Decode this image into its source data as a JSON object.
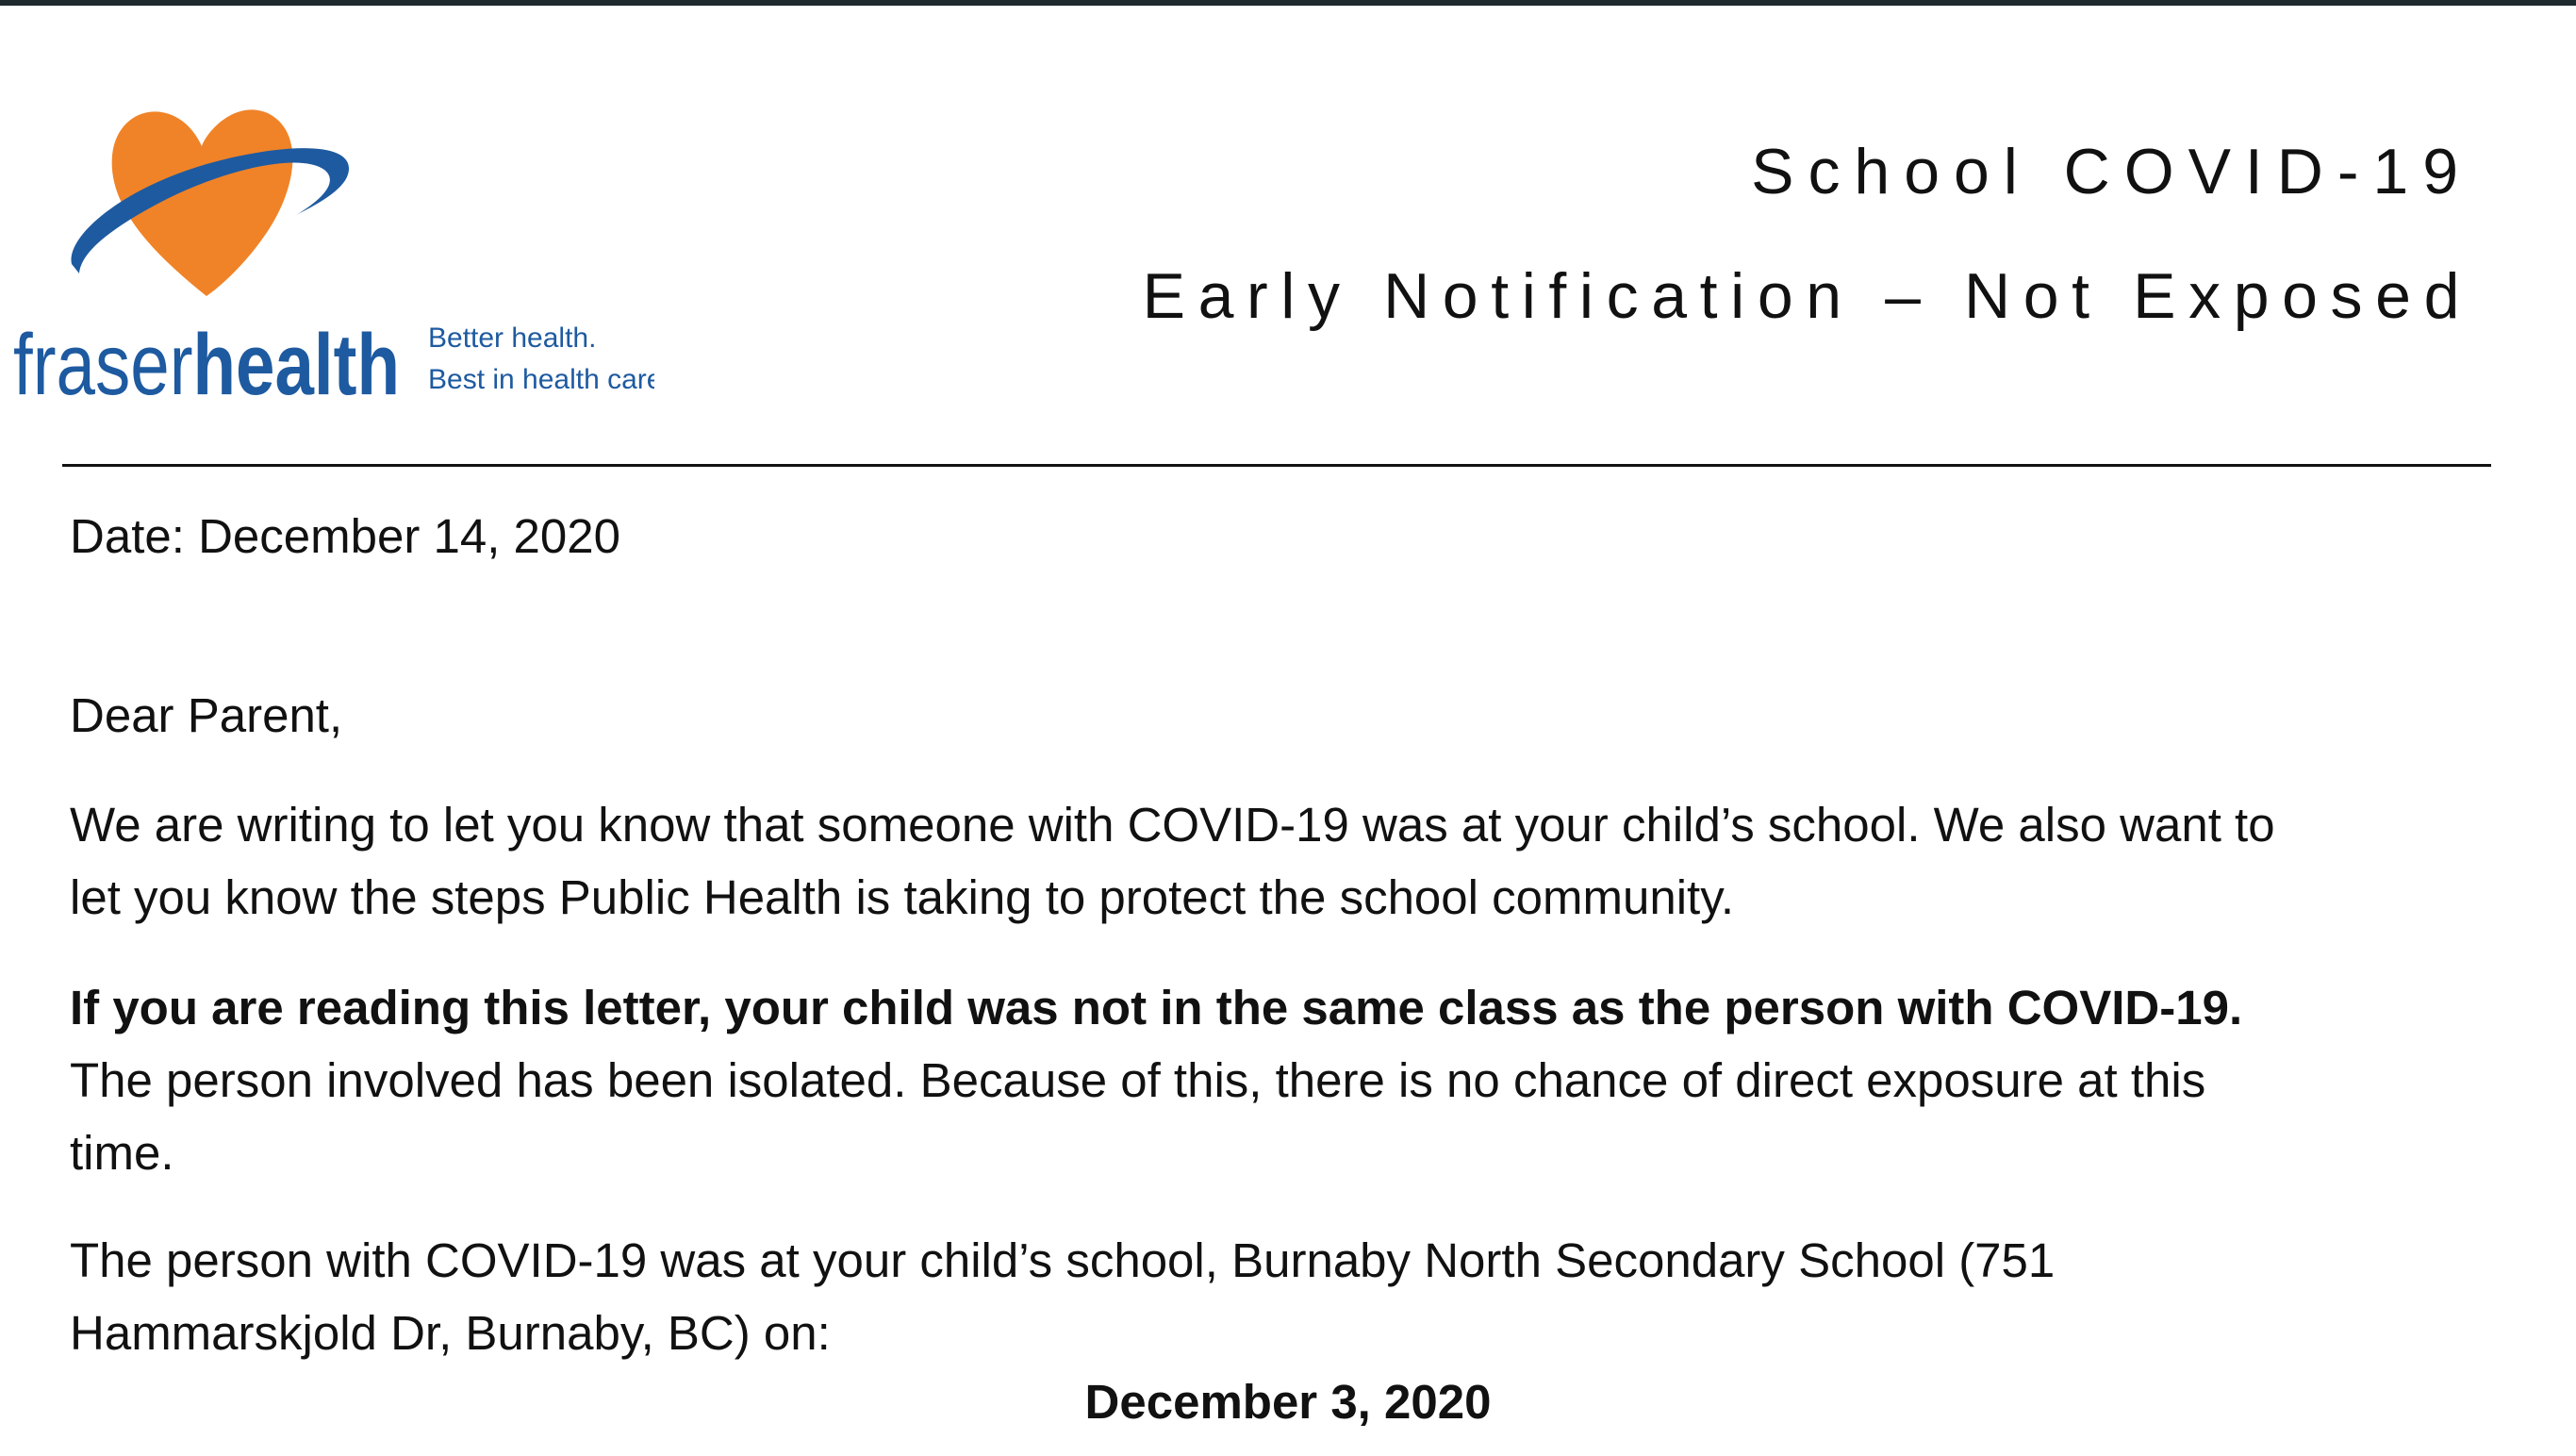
{
  "logo": {
    "brand_light": "fraser",
    "brand_bold": "health",
    "tagline_line1": "Better health.",
    "tagline_line2": "Best in health care.",
    "colors": {
      "heart": "#f08327",
      "swoosh": "#1e5aa0",
      "wordmark": "#1e5aa0"
    }
  },
  "header": {
    "title": "School COVID-19",
    "subtitle": "Early Notification – Not Exposed"
  },
  "letter": {
    "date": "Date: December 14, 2020",
    "salutation": "Dear Parent,",
    "para1_line1": "We are writing to let you know that someone with COVID-19 was at your child’s school. We also want to",
    "para1_line2": "let you know the steps Public Health is taking to protect the school community.",
    "para2_bold": "If you are reading this letter, your child was not in the same class as the person with COVID-19.",
    "para2_line2": "The person involved has been isolated. Because of this, there is no chance of direct exposure at this",
    "para2_line3": "time.",
    "para3_line1": "The person with COVID-19 was at your child’s school, Burnaby North Secondary School (751",
    "para3_line2": "Hammarskjold Dr, Burnaby, BC) on:",
    "exposure_date": "December 3, 2020"
  }
}
